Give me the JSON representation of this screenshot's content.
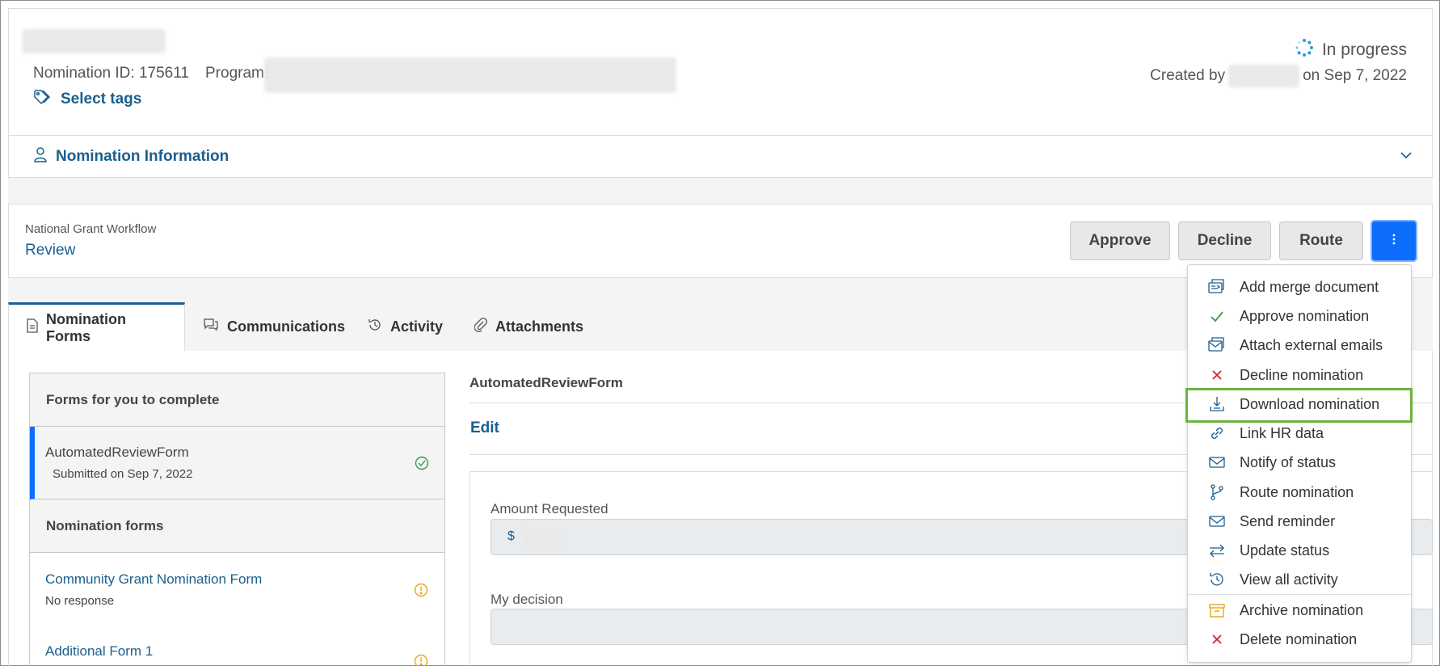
{
  "header": {
    "nomination_id": "Nomination ID: 175611",
    "program_label": "Program:",
    "select_tags": "Select tags",
    "status": "In progress",
    "created_prefix": "Created by",
    "created_suffix": "on Sep 7, 2022"
  },
  "nomination_info": {
    "label": "Nomination Information"
  },
  "workflow": {
    "name": "National Grant Workflow",
    "stage": "Review",
    "buttons": {
      "approve": "Approve",
      "decline": "Decline",
      "route": "Route"
    }
  },
  "tabs": [
    {
      "label": "Nomination Forms",
      "icon": "document-icon",
      "active": true
    },
    {
      "label": "Communications",
      "icon": "chat-icon",
      "active": false
    },
    {
      "label": "Activity",
      "icon": "history-icon",
      "active": false
    },
    {
      "label": "Attachments",
      "icon": "paperclip-icon",
      "active": false
    }
  ],
  "forms_list": {
    "section1": "Forms for you to complete",
    "selected_form": {
      "name": "AutomatedReviewForm",
      "sub": "Submitted on Sep 7, 2022"
    },
    "section2": "Nomination forms",
    "items": [
      {
        "name": "Community Grant Nomination Form",
        "sub": "No response"
      },
      {
        "name": "Additional Form 1",
        "sub": ""
      }
    ]
  },
  "form_panel": {
    "title": "AutomatedReviewForm",
    "edit": "Edit",
    "amount_label": "Amount Requested",
    "currency_symbol": "$",
    "decision_label": "My decision"
  },
  "menu": {
    "items": [
      {
        "label": "Add merge document",
        "icon": "merge-document-icon",
        "color": "#1a5f8e"
      },
      {
        "label": "Approve nomination",
        "icon": "check-icon",
        "color": "#2e9e4f"
      },
      {
        "label": "Attach external emails",
        "icon": "attach-email-icon",
        "color": "#1a5f8e"
      },
      {
        "label": "Decline nomination",
        "icon": "x-icon",
        "color": "#d0212f"
      },
      {
        "label": "Download nomination",
        "icon": "download-icon",
        "color": "#1a5f8e"
      },
      {
        "label": "Link HR data",
        "icon": "link-icon",
        "color": "#1a5f8e"
      },
      {
        "label": "Notify of status",
        "icon": "envelope-icon",
        "color": "#1a5f8e"
      },
      {
        "label": "Route nomination",
        "icon": "route-icon",
        "color": "#1a5f8e"
      },
      {
        "label": "Send reminder",
        "icon": "envelope-icon",
        "color": "#1a5f8e"
      },
      {
        "label": "Update status",
        "icon": "swap-arrows-icon",
        "color": "#1a5f8e"
      },
      {
        "label": "View all activity",
        "icon": "history-icon",
        "color": "#1a5f8e"
      },
      {
        "label": "Archive nomination",
        "icon": "archive-icon",
        "color": "#e6a817"
      },
      {
        "label": "Delete nomination",
        "icon": "x-icon",
        "color": "#d0212f"
      }
    ]
  },
  "colors": {
    "link": "#1a5f8e",
    "primary_button": "#0d6efd",
    "highlight": "#6db33f",
    "warning": "#e6a817",
    "success": "#2e9e4f"
  }
}
